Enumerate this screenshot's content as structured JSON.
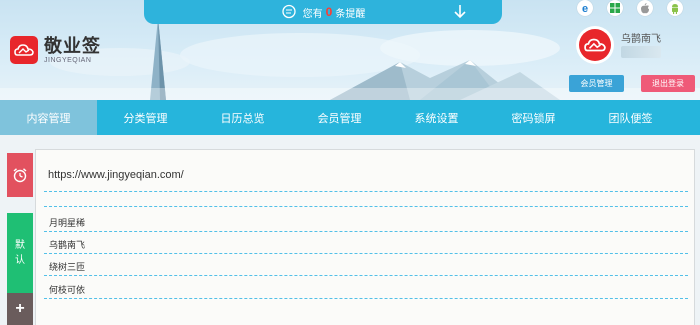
{
  "app": {
    "name_cn": "敬业签",
    "name_en": "JINGYEQIAN"
  },
  "notice": {
    "prefix": "您有",
    "count": "0",
    "suffix": "条提醒"
  },
  "platforms": [
    "ie-icon",
    "windows-icon",
    "apple-icon",
    "android-icon"
  ],
  "user": {
    "name": "乌鹊南飞",
    "member_button": "会员管理",
    "logout_button": "退出登录"
  },
  "nav": {
    "items": [
      "内容管理",
      "分类管理",
      "日历总览",
      "会员管理",
      "系统设置",
      "密码锁屏",
      "团队便签"
    ],
    "active_index": 0
  },
  "sidebar": {
    "default_label_1": "默",
    "default_label_2": "认",
    "add_label": "+"
  },
  "content": {
    "url": "https://www.jingyeqian.com/",
    "items": [
      "月明星稀",
      "乌鹊南飞",
      "绕树三匝",
      "何枝可依"
    ]
  },
  "colors": {
    "nav_bg": "#26b5dc",
    "nav_active": "#7fc3dc",
    "notice_bg": "#2eb3dc",
    "brand_red": "#e8262b",
    "alarm_red": "#e2515f",
    "default_green": "#1fbf74",
    "add_brown": "#6a5c5c",
    "member_button": "#3aa3d7",
    "logout_button": "#ef5a78",
    "dash_line": "#52c0e8"
  }
}
